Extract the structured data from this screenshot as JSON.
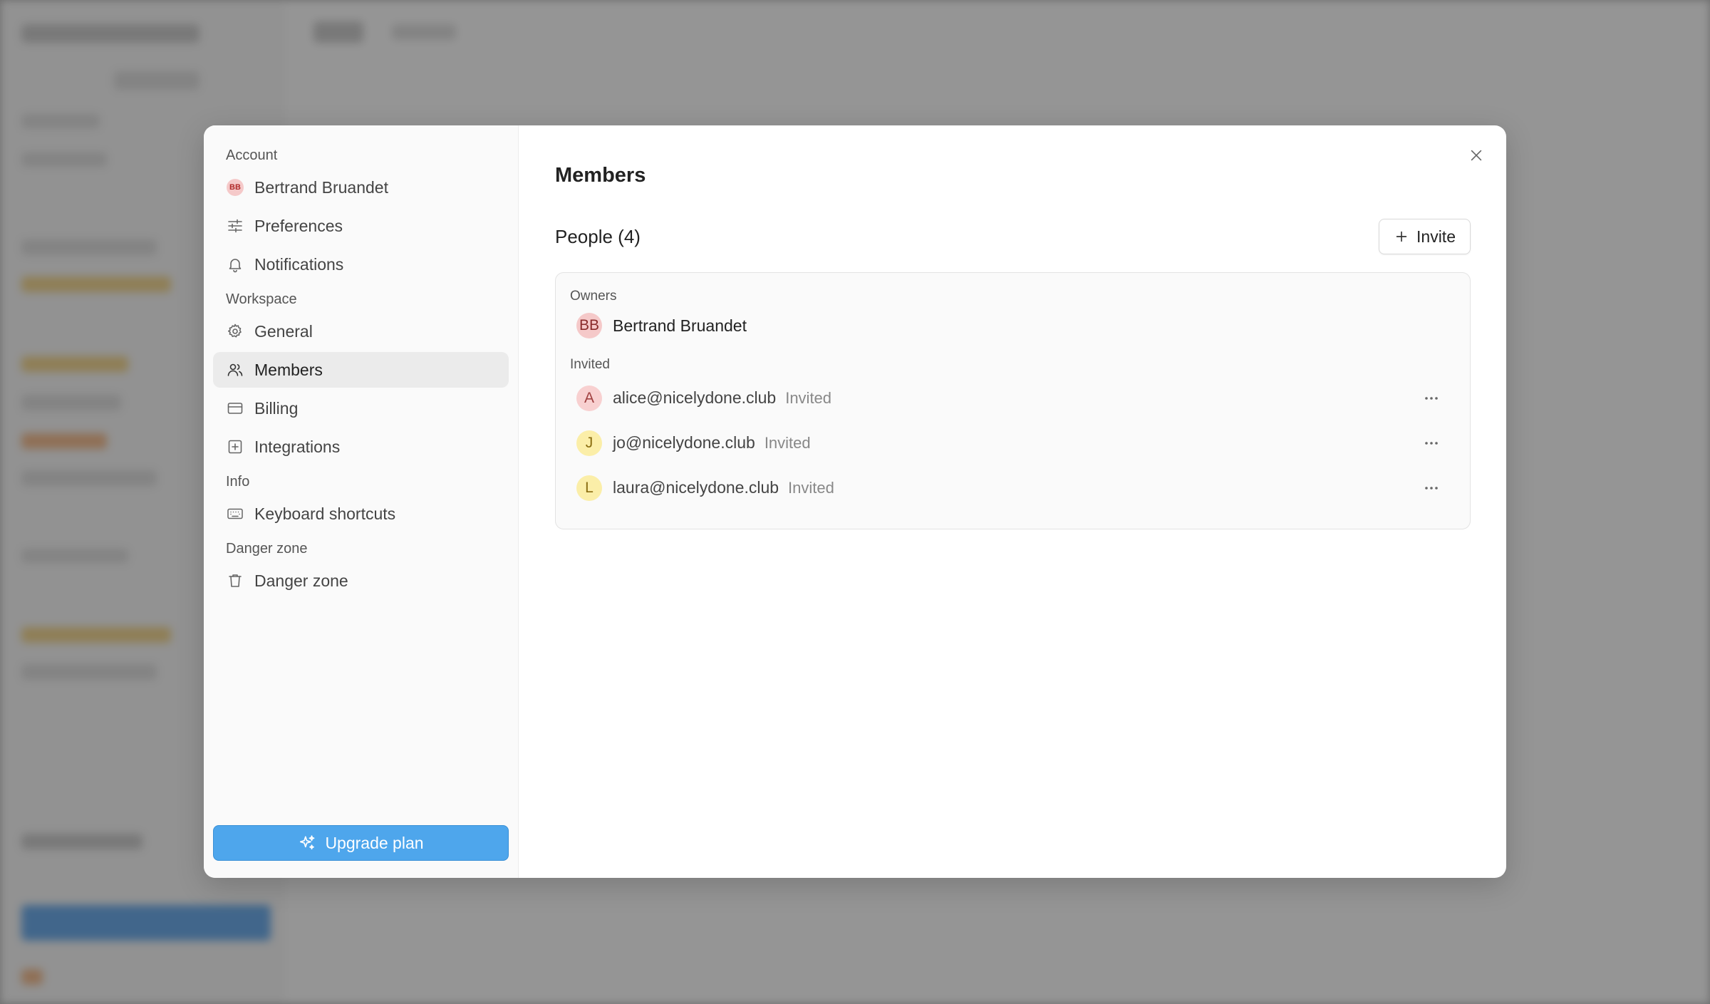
{
  "colors": {
    "accent_blue": "#4ea6ec",
    "active_bg": "#ebebeb",
    "owner_avatar": "#f5c9c9",
    "invite_avatar_pink": "#f8d0d0",
    "invite_avatar_yellow": "#fbeea8"
  },
  "sidebar": {
    "sections": {
      "account": "Account",
      "workspace": "Workspace",
      "info": "Info",
      "danger": "Danger zone"
    },
    "account_items": [
      {
        "label": "Bertrand Bruandet",
        "icon": "user-avatar-icon",
        "avatar_initials": "BB"
      },
      {
        "label": "Preferences",
        "icon": "sliders-icon"
      },
      {
        "label": "Notifications",
        "icon": "bell-icon"
      }
    ],
    "workspace_items": [
      {
        "label": "General",
        "icon": "gear-icon"
      },
      {
        "label": "Members",
        "icon": "users-icon",
        "active": true
      },
      {
        "label": "Billing",
        "icon": "credit-card-icon"
      },
      {
        "label": "Integrations",
        "icon": "plus-square-icon"
      }
    ],
    "info_items": [
      {
        "label": "Keyboard shortcuts",
        "icon": "keyboard-icon"
      }
    ],
    "danger_items": [
      {
        "label": "Danger zone",
        "icon": "trash-icon"
      }
    ],
    "upgrade_label": "Upgrade plan"
  },
  "main": {
    "title": "Members",
    "people_title": "People (4)",
    "invite_label": "Invite",
    "owners_label": "Owners",
    "invited_label": "Invited",
    "owners": [
      {
        "initials": "BB",
        "name": "Bertrand Bruandet"
      }
    ],
    "invited": [
      {
        "initial": "A",
        "email": "alice@nicelydone.club",
        "status": "Invited"
      },
      {
        "initial": "J",
        "email": "jo@nicelydone.club",
        "status": "Invited"
      },
      {
        "initial": "L",
        "email": "laura@nicelydone.club",
        "status": "Invited"
      }
    ]
  }
}
